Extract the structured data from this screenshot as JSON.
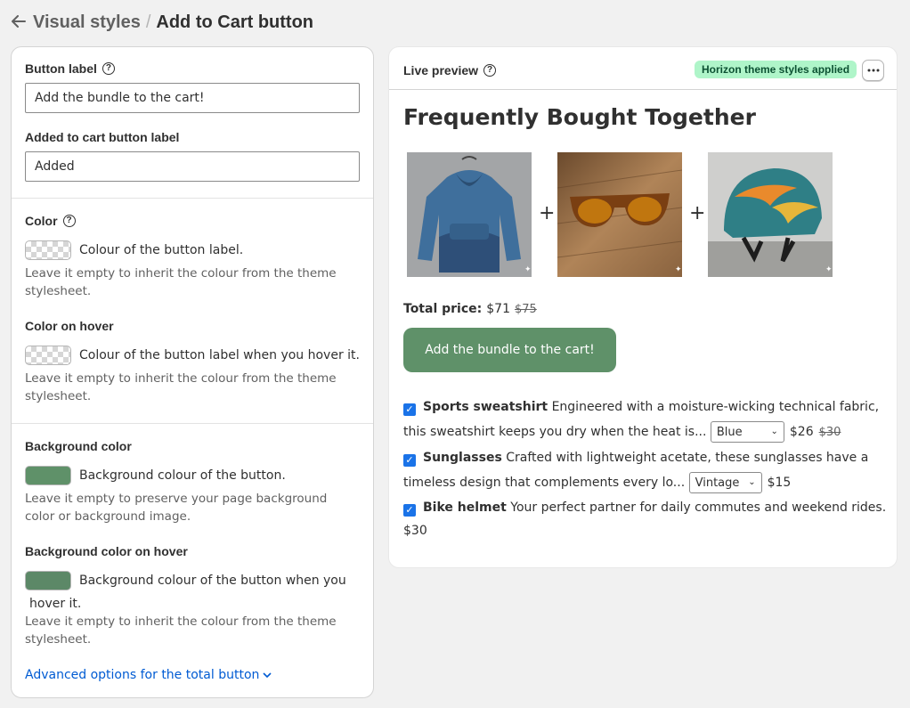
{
  "header": {
    "back_icon": "arrow-left-icon",
    "parent": "Visual styles",
    "separator": "/",
    "title": "Add to Cart button"
  },
  "settings": {
    "button_label": {
      "label": "Button label",
      "value": "Add the bundle to the cart!"
    },
    "added_label": {
      "label": "Added to cart button label",
      "value": "Added"
    },
    "color": {
      "label": "Color",
      "desc": "Colour of the button label.",
      "help": "Leave it empty to inherit the colour from the theme stylesheet."
    },
    "color_hover": {
      "label": "Color on hover",
      "desc": "Colour of the button label when you hover it.",
      "help": "Leave it empty to inherit the colour from the theme stylesheet."
    },
    "bg_color": {
      "label": "Background color",
      "desc": "Background colour of the button.",
      "help": "Leave it empty to preserve your page background color or background image.",
      "swatch": "#5f9169"
    },
    "bg_hover": {
      "label": "Background color on hover",
      "desc_line1": "Background colour of the button when you",
      "desc_line2": "hover it.",
      "help": "Leave it empty to inherit the colour from the theme stylesheet.",
      "swatch": "#5c8867"
    },
    "advanced_link": "Advanced options for the total button"
  },
  "preview": {
    "title": "Live preview",
    "badge": "Horizon theme styles applied",
    "more": "•••",
    "fbt_title": "Frequently Bought Together",
    "plus": "+",
    "total_label": "Total price:",
    "total_price": "$71",
    "total_compare": "$75",
    "cart_button": "Add the bundle to the cart!",
    "items": [
      {
        "name": "Sports sweatshirt",
        "desc": "Engineered with a moisture-wicking technical fabric, this sweatshirt keeps you dry when the heat is...",
        "variant": "Blue",
        "price": "$26",
        "compare": "$30"
      },
      {
        "name": "Sunglasses",
        "desc": "Crafted with lightweight acetate, these sunglasses have a timeless design that complements every lo...",
        "variant": "Vintage",
        "price": "$15"
      },
      {
        "name": "Bike helmet",
        "desc": "Your perfect partner for daily commutes and weekend rides.",
        "price": "$30"
      }
    ]
  },
  "colors": {
    "accent": "#5f9169",
    "link": "#005bd3",
    "badge_bg": "#aff5c9",
    "checkbox": "#1a73e8"
  }
}
